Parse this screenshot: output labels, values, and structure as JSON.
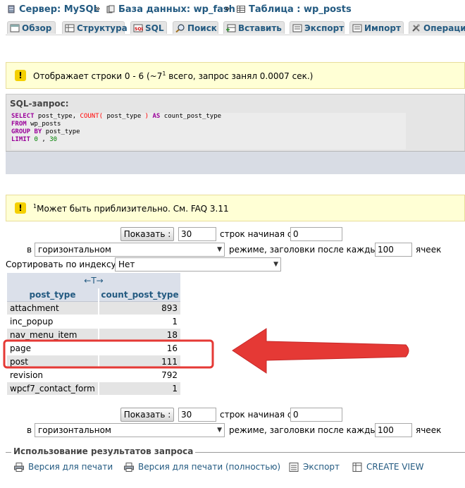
{
  "breadcrumb": {
    "server": "Сервер: MySQL",
    "database": "База данных: wp_fash",
    "table": "Таблица : wp_posts",
    "separator": "»"
  },
  "tabs": [
    {
      "label": "Обзор",
      "icon": "browse-icon"
    },
    {
      "label": "Структура",
      "icon": "structure-icon"
    },
    {
      "label": "SQL",
      "icon": "sql-icon"
    },
    {
      "label": "Поиск",
      "icon": "search-icon"
    },
    {
      "label": "Вставить",
      "icon": "insert-icon"
    },
    {
      "label": "Экспорт",
      "icon": "export-icon"
    },
    {
      "label": "Импорт",
      "icon": "import-icon"
    },
    {
      "label": "Операции",
      "icon": "operations-icon"
    }
  ],
  "notice_rows": {
    "prefix": "Отображает строки 0 - 6 (~7",
    "sup": "1",
    "suffix": " всего, запрос занял 0.0007 сек.)"
  },
  "sql": {
    "title": "SQL-запрос:",
    "kw_select": "SELECT",
    "select_body": " post_type, ",
    "fn_count": "COUNT(",
    "count_arg": " post_type ",
    "fn_close": ")",
    "kw_as": " AS",
    "alias": " count_post_type",
    "kw_from": "FROM",
    "from_table": " wp_posts",
    "kw_group": "GROUP BY",
    "group_col": " post_type",
    "kw_limit": "LIMIT",
    "limit_a": " 0",
    "limit_comma": " , ",
    "limit_b": "30"
  },
  "notice_approx": {
    "sup": "1",
    "text": "Может быть приблизительно. См. FAQ 3.11"
  },
  "nav_top": {
    "show_button": "Показать :",
    "rows_value": "30",
    "rows_from_label": "строк начиная с",
    "start_value": "0",
    "in_label": "в",
    "mode_value": "горизонтальном",
    "mode_label": "режиме, заголовки после каждых",
    "repeat_value": "100",
    "cells_label": "ячеек"
  },
  "sort": {
    "label": "Сортировать по индексу:",
    "value": "Нет"
  },
  "table": {
    "arrows": "←T→",
    "columns": [
      "post_type",
      "count_post_type"
    ],
    "rows": [
      {
        "post_type": "attachment",
        "count": "893"
      },
      {
        "post_type": "inc_popup",
        "count": "1"
      },
      {
        "post_type": "nav_menu_item",
        "count": "18"
      },
      {
        "post_type": "page",
        "count": "16"
      },
      {
        "post_type": "post",
        "count": "111"
      },
      {
        "post_type": "revision",
        "count": "792"
      },
      {
        "post_type": "wpcf7_contact_form",
        "count": "1"
      }
    ]
  },
  "nav_bottom": {
    "show_button": "Показать :",
    "rows_value": "30",
    "rows_from_label": "строк начиная с",
    "start_value": "0",
    "in_label": "в",
    "mode_value": "горизонтальном",
    "mode_label": "режиме, заголовки после каждых",
    "repeat_value": "100",
    "cells_label": "ячеек"
  },
  "query_results": {
    "legend": "Использование результатов запроса",
    "print_view": "Версия для печати",
    "print_view_full": "Версия для печати (полностью)",
    "export": "Экспорт",
    "create_view": "CREATE VIEW"
  },
  "annotation": {
    "highlight_color": "#e53935",
    "arrow_color": "#e53935"
  }
}
